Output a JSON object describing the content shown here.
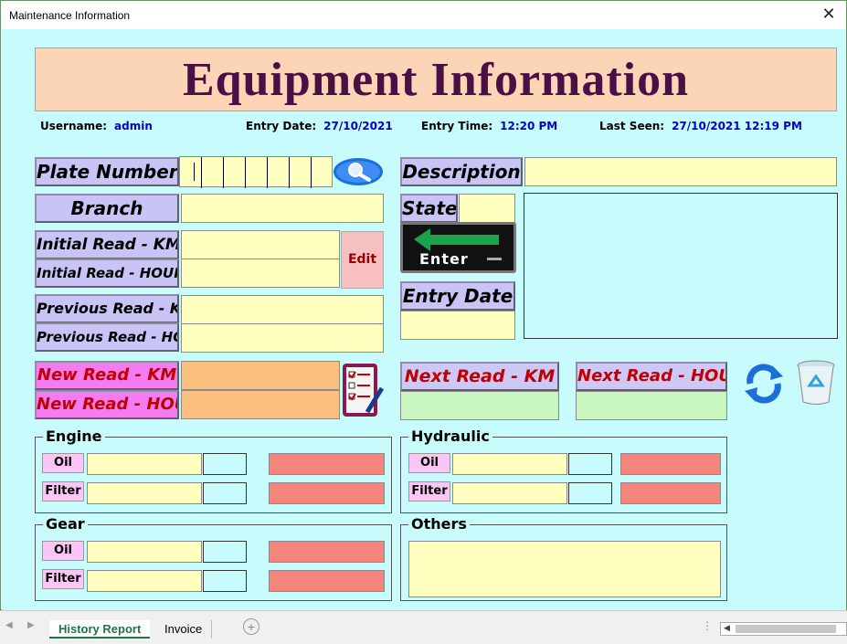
{
  "window": {
    "title": "Maintenance Information",
    "close": "✕"
  },
  "banner": {
    "title": "Equipment Information"
  },
  "info": {
    "username_label": "Username:",
    "username": "admin",
    "entry_date_label": "Entry Date:",
    "entry_date": "27/10/2021",
    "entry_time_label": "Entry Time:",
    "entry_time": "12:20 PM",
    "last_seen_label": "Last Seen:",
    "last_seen": "27/10/2021 12:19 PM"
  },
  "labels": {
    "plate_number": "Plate Number",
    "branch": "Branch",
    "initial_km": "Initial Read - KM",
    "initial_hour": "Initial Read - HOUR",
    "previous_km": "Previous Read - KM",
    "previous_hour": "Previous Read - HOUR",
    "new_km": "New Read - KM",
    "new_hour": "New Read - HOUR",
    "description": "Description",
    "state": "State",
    "entry_date": "Entry Date",
    "next_km": "Next Read - KM",
    "next_hour": "Next Read - HOUR"
  },
  "buttons": {
    "edit": "Edit",
    "enter": "Enter"
  },
  "groups": {
    "engine": "Engine",
    "hydraulic": "Hydraulic",
    "gear": "Gear",
    "others": "Others",
    "oil": "Oil",
    "filter": "Filter"
  },
  "sheet_tabs": {
    "history": "History Report",
    "invoice": "Invoice"
  },
  "icons": [
    "search-icon",
    "enter-arrow-icon",
    "checklist-icon",
    "refresh-icon",
    "recycle-bin-icon",
    "close-icon",
    "add-sheet-icon"
  ],
  "colors": {
    "form_bg": "#c8fcfc",
    "banner_bg": "#fbd5b5",
    "banner_text": "#4a0f45",
    "label_bg": "#c9c4f6",
    "field_yellow": "#ffffc0",
    "field_orange": "#fbbf7f",
    "field_green": "#c8f5c0",
    "status_red": "#f4867e"
  }
}
